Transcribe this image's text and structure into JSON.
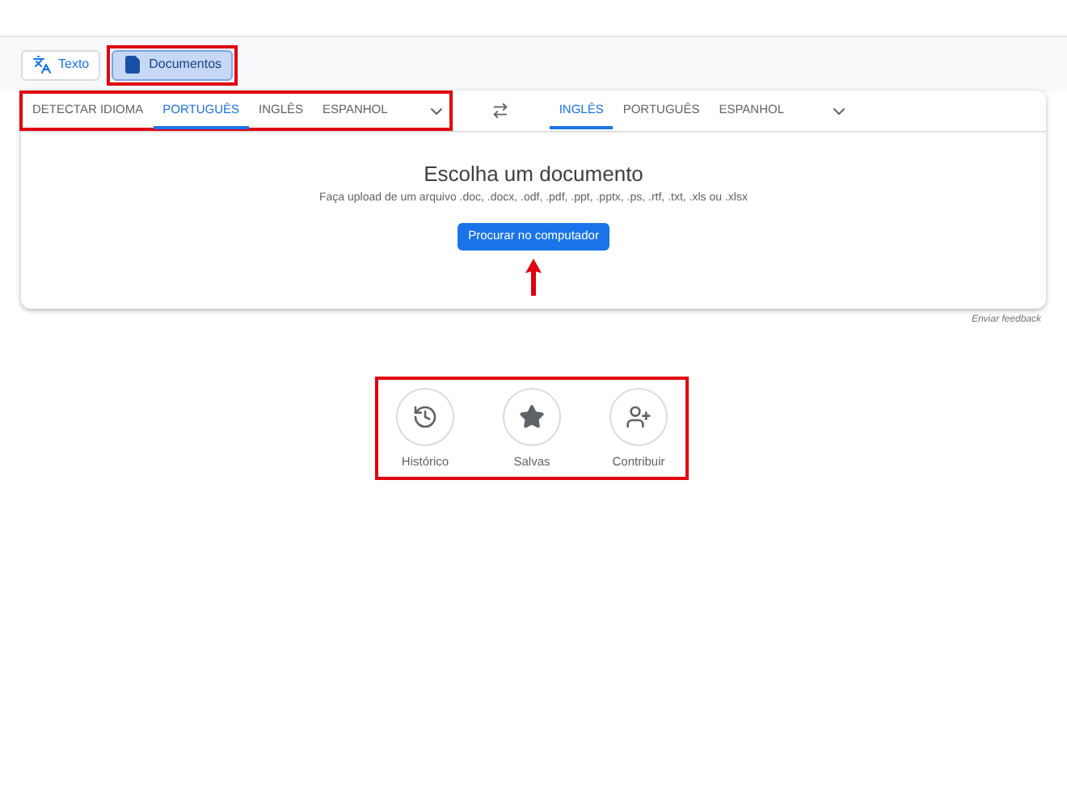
{
  "mode_tabs": [
    {
      "label": "Texto",
      "kind": "text",
      "selected": false
    },
    {
      "label": "Documentos",
      "kind": "document",
      "selected": true
    }
  ],
  "source_languages": [
    {
      "label": "DETECTAR IDIOMA",
      "selected": false
    },
    {
      "label": "PORTUGUÊS",
      "selected": true
    },
    {
      "label": "INGLÊS",
      "selected": false
    },
    {
      "label": "ESPANHOL",
      "selected": false
    }
  ],
  "target_languages": [
    {
      "label": "INGLÊS",
      "selected": true
    },
    {
      "label": "PORTUGUÊS",
      "selected": false
    },
    {
      "label": "ESPANHOL",
      "selected": false
    }
  ],
  "upload": {
    "title": "Escolha um documento",
    "subtitle": "Faça upload de um arquivo .doc, .docx, .odf, .pdf, .ppt, .pptx, .ps, .rtf, .txt, .xls ou .xlsx",
    "button": "Procurar no computador"
  },
  "feedback": "Enviar feedback",
  "actions": [
    {
      "label": "Histórico",
      "kind": "history"
    },
    {
      "label": "Salvas",
      "kind": "saved"
    },
    {
      "label": "Contribuir",
      "kind": "contribute"
    }
  ]
}
